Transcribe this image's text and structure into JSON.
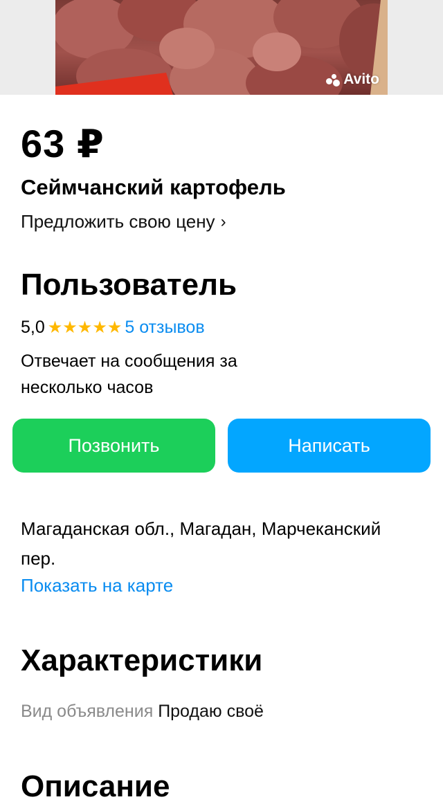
{
  "photo": {
    "watermark": "Avito",
    "icon": "avito-logo-icon"
  },
  "listing": {
    "price": "63 ₽",
    "title": "Сеймчанский картофель",
    "offer_price_link": "Предложить свою цену",
    "offer_chevron_icon": "chevron-right-icon"
  },
  "seller": {
    "name": "Пользователь",
    "rating": "5,0",
    "stars": "★★★★★",
    "reviews_link": "5 отзывов",
    "reply_time": "Отвечает на сообщения за несколько часов"
  },
  "actions": {
    "call_label": "Позвонить",
    "write_label": "Написать",
    "call_color": "#1ccf5a",
    "write_color": "#03a6ff"
  },
  "location": {
    "address": "Магаданская обл., Магадан, Марчеканский пер.",
    "map_link": "Показать на карте"
  },
  "specs": {
    "heading": "Характеристики",
    "items": [
      {
        "key": "Вид объявления",
        "value": "Продаю своё"
      }
    ]
  },
  "description": {
    "heading": "Описание"
  },
  "colors": {
    "link": "#0a8cf0",
    "star": "#ffb800"
  }
}
